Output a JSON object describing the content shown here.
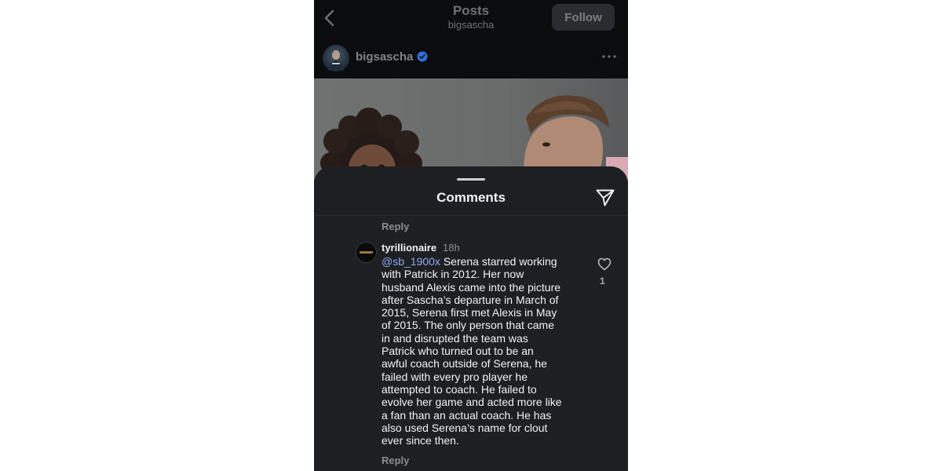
{
  "header": {
    "title": "Posts",
    "subtitle": "bigsascha",
    "follow_label": "Follow"
  },
  "post": {
    "username": "bigsascha",
    "verified": true
  },
  "comments_sheet": {
    "title": "Comments",
    "reply_label_top": "Reply",
    "comment": {
      "username": "tyrillionaire",
      "time": "18h",
      "mention": "@sb_1900x",
      "lines": [
        "Serena starred working",
        "with Patrick in 2012. Her now",
        "husband Alexis came into the picture",
        "after Sascha’s departure in March of",
        "2015, Serena first met Alexis in May",
        "of 2015. The only person that came",
        "in and disrupted the team was",
        "Patrick who turned out to be an",
        "awful coach outside of Serena, he",
        "failed with every pro player he",
        "attempted to coach. He failed to",
        "evolve her game and acted more like",
        "a fan than an actual coach. He has",
        "also used Serena’s name for clout",
        "ever since then."
      ],
      "like_count": "1",
      "reply_label": "Reply"
    }
  },
  "icons": {
    "back": "chevron-left-icon",
    "verified": "verified-badge-icon",
    "more": "more-horizontal-icon",
    "share": "paper-plane-icon",
    "like": "heart-outline-icon"
  },
  "colors": {
    "mention": "#8fa6ef",
    "verified": "#2f6fd6",
    "sheet_bg": "#1d1f22"
  }
}
